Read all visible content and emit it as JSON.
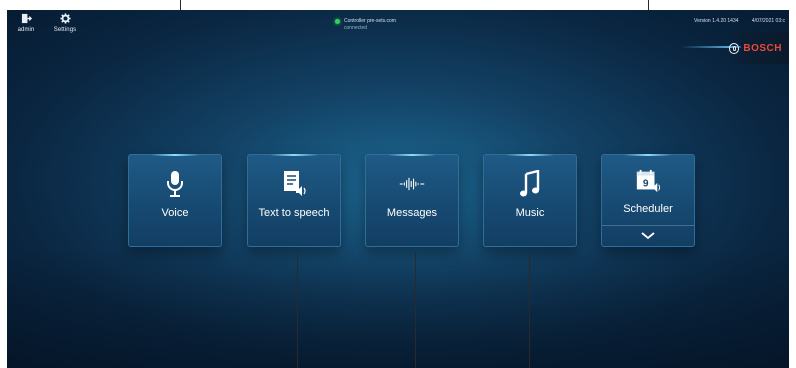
{
  "topbar": {
    "admin_label": "admin",
    "settings_label": "Settings",
    "status_line1": "Controller pre-sets.com",
    "status_line2": "connected",
    "version_text": "Version 1.4.20 1434",
    "date_text": "4/07/2021 03:c"
  },
  "brand": {
    "name": "BOSCH"
  },
  "tiles": [
    {
      "label": "Voice",
      "icon": "microphone-icon"
    },
    {
      "label": "Text to speech",
      "icon": "text-to-speech-icon"
    },
    {
      "label": "Messages",
      "icon": "waveform-icon"
    },
    {
      "label": "Music",
      "icon": "music-note-icon"
    },
    {
      "label": "Scheduler",
      "icon": "calendar-icon",
      "calendar_day": "9",
      "has_expand": true
    }
  ],
  "colors": {
    "accent": "#8fdcff",
    "status_ok": "#2fd35a",
    "brand_red": "#e84a3c"
  }
}
